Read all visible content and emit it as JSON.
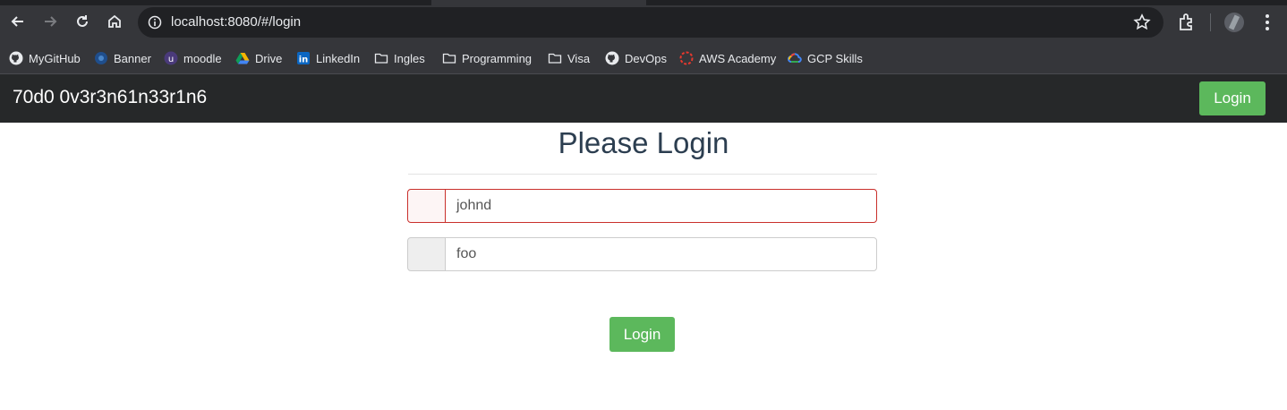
{
  "browser": {
    "url": "localhost:8080/#/login",
    "bookmarks": [
      {
        "label": "MyGitHub",
        "icon": "github-icon"
      },
      {
        "label": "Banner",
        "icon": "banner-icon"
      },
      {
        "label": "moodle",
        "icon": "moodle-icon"
      },
      {
        "label": "Drive",
        "icon": "drive-icon"
      },
      {
        "label": "LinkedIn",
        "icon": "linkedin-icon"
      },
      {
        "label": "Ingles",
        "icon": "folder-icon"
      },
      {
        "label": "Programming",
        "icon": "folder-icon"
      },
      {
        "label": "Visa",
        "icon": "folder-icon"
      },
      {
        "label": "DevOps",
        "icon": "github-icon"
      },
      {
        "label": "AWS Academy",
        "icon": "aws-icon"
      },
      {
        "label": "GCP Skills",
        "icon": "gcp-icon"
      }
    ]
  },
  "navbar": {
    "brand": "70d0 0v3r3n61n33r1n6",
    "login_label": "Login"
  },
  "form": {
    "title": "Please Login",
    "username_value": "johnd",
    "password_value": "foo",
    "submit_label": "Login"
  },
  "colors": {
    "success": "#5cb85c",
    "error_border": "#c9302c",
    "navbar_bg": "#262829",
    "title_color": "#2c3e50"
  }
}
